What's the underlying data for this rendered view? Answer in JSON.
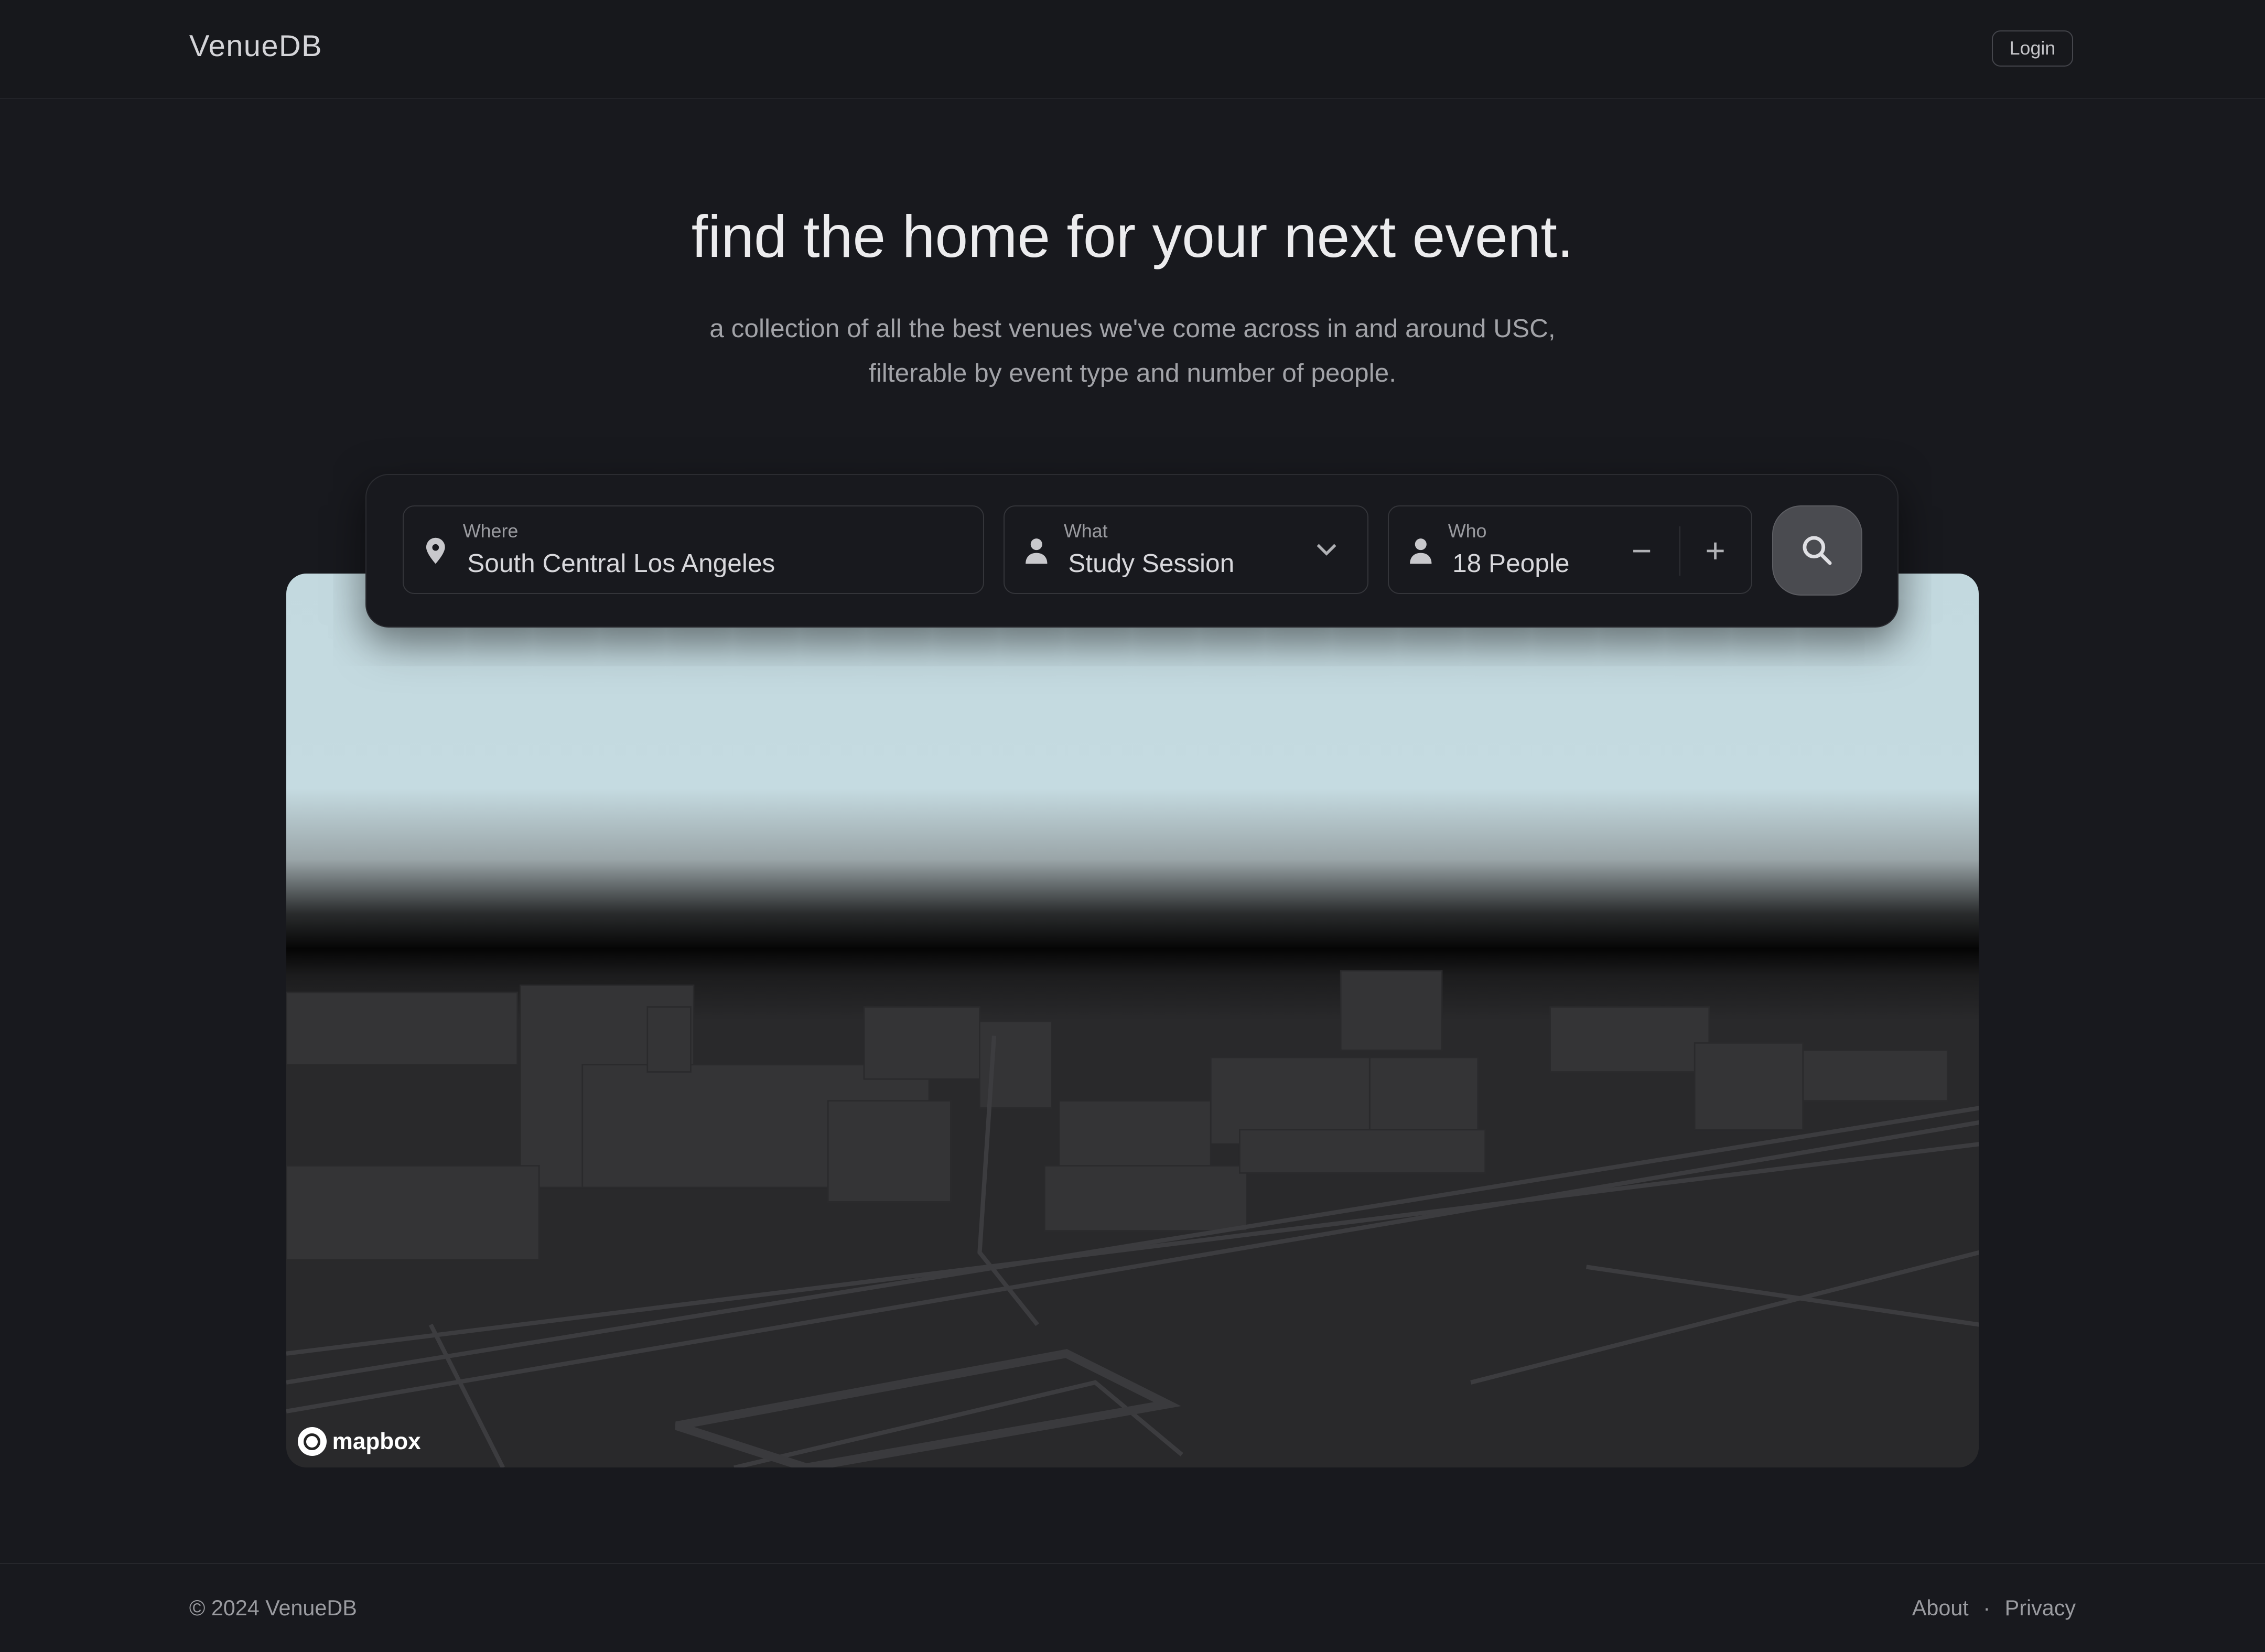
{
  "header": {
    "logo": "VenueDB",
    "login_label": "Login"
  },
  "hero": {
    "title": "find the home for your next event.",
    "subtitle_line1": "a collection of all the best venues we've come across in and around USC,",
    "subtitle_line2": "filterable by event type and number of people."
  },
  "search": {
    "where": {
      "label": "Where",
      "value": "South Central Los Angeles",
      "icon": "map-pin-icon"
    },
    "what": {
      "label": "What",
      "value": "Study Session",
      "icon": "person-icon"
    },
    "who": {
      "label": "Who",
      "value": "18 People",
      "icon": "person-icon",
      "decrement": "−",
      "increment": "+"
    },
    "button_icon": "search-icon"
  },
  "map": {
    "attribution": "mapbox",
    "colors": {
      "sky": "#c5dbe1",
      "ground": "#29292b"
    }
  },
  "footer": {
    "copyright": "© 2024 VenueDB",
    "links": [
      "About",
      "Privacy"
    ],
    "separator": "·"
  }
}
